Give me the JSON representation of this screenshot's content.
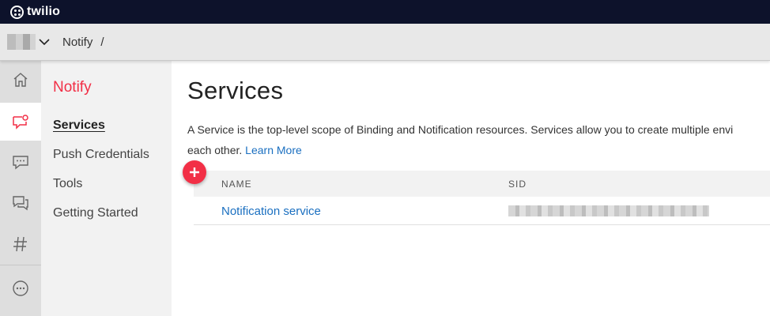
{
  "brand": {
    "name": "twilio",
    "color": "#f22f46",
    "topbar_bg": "#0d122b"
  },
  "breadcrumb": {
    "items": [
      "Notify"
    ],
    "separator": "/"
  },
  "rail": [
    {
      "icon": "home-icon"
    },
    {
      "icon": "notify-chat-icon",
      "active": true
    },
    {
      "icon": "sms-chat-icon"
    },
    {
      "icon": "conversations-icon"
    },
    {
      "icon": "hash-icon"
    },
    {
      "icon": "more-dots-icon"
    }
  ],
  "subnav": {
    "title": "Notify",
    "items": [
      "Services",
      "Push Credentials",
      "Tools",
      "Getting Started"
    ]
  },
  "main": {
    "title": "Services",
    "description_line1": "A Service is the top-level scope of Binding and Notification resources. Services allow you to create multiple envi",
    "description_line2": "each other.",
    "learn_more": "Learn More"
  },
  "table": {
    "columns": [
      "NAME",
      "SID"
    ],
    "rows": [
      {
        "name": "Notification service"
      }
    ]
  }
}
